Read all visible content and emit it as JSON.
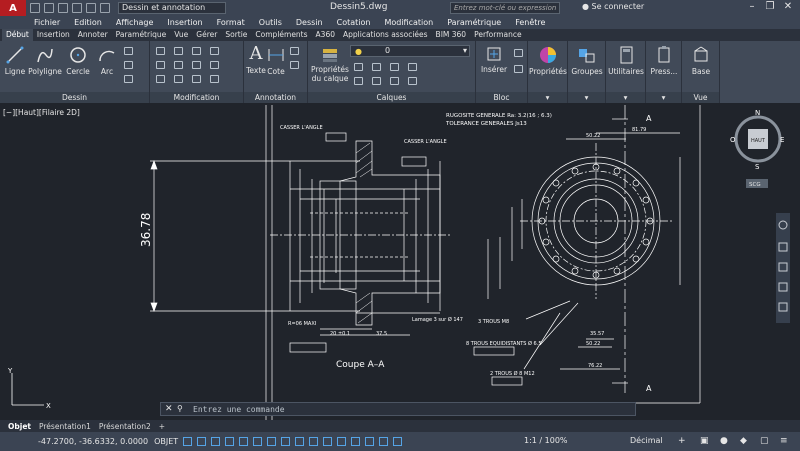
{
  "title_bar": {
    "logo": "A",
    "workspace": "Dessin et annotation",
    "document_title": "Dessin5.dwg",
    "search_placeholder": "Entrez mot-clé ou expression",
    "sign_in": "Se connecter"
  },
  "menu": [
    "Fichier",
    "Edition",
    "Affichage",
    "Insertion",
    "Format",
    "Outils",
    "Dessin",
    "Cotation",
    "Modification",
    "Paramétrique",
    "Fenêtre"
  ],
  "ribbon_tabs": [
    "Début",
    "Insertion",
    "Annoter",
    "Paramétrique",
    "Vue",
    "Gérer",
    "Sortie",
    "Compléments",
    "A360",
    "Applications associées",
    "BIM 360",
    "Performance"
  ],
  "ribbon_active_tab": "Début",
  "panels": {
    "dessin": {
      "label": "Dessin",
      "tools": [
        "Ligne",
        "Polyligne",
        "Cercle",
        "Arc"
      ]
    },
    "modification": {
      "label": "Modification"
    },
    "annotation": {
      "label": "Annotation",
      "tools": [
        "Texte",
        "Cote"
      ]
    },
    "calques": {
      "label": "Calques",
      "tools": [
        "Propriétés du calque"
      ],
      "layer_value": "0"
    },
    "bloc": {
      "label": "Bloc",
      "tools": [
        "Insérer"
      ]
    },
    "proprietes": {
      "label": "Propriétés"
    },
    "groupes": {
      "label": "Groupes"
    },
    "utilitaires": {
      "label": "Utilitaires"
    },
    "presse": {
      "label": "Press..."
    },
    "vue": {
      "label": "Vue",
      "tools": [
        "Base"
      ]
    }
  },
  "viewport_label": "[−][Haut][Filaire 2D]",
  "viewcube": {
    "face": "HAUT",
    "n": "N",
    "s": "S",
    "e": "E",
    "o": "O",
    "ucs": "SCG"
  },
  "drawing_text": {
    "rugosite": "RUGOSITE GENERALE Ra: 3.2(16 ; 6.3)",
    "tolerance": "TOLERANCE GENERALES Js13",
    "casser_angle_1": "CASSER L'ANGLE",
    "casser_angle_2": "CASSER L'ANGLE",
    "big_dim": "36.78",
    "coupe": "Coupe A–A",
    "section_a": "A",
    "dim_5022": "50.22",
    "dim_8179": "81.79",
    "dim_7622": "76.22",
    "dim_3557": "35.57",
    "trous_m8": "3 TROUS M8",
    "trous_equi": "8 TROUS EQUIDISTANTS Ø 6.5",
    "trous_m12": "2 TROUS Ø 8 M12",
    "r06": "R=06 MAXI",
    "dim_20": "20 ±0.1",
    "dim_375": "37.5",
    "lamage": "Lamage 3 sur Ø 147"
  },
  "command": {
    "placeholder": "Entrez une commande"
  },
  "layout_tabs": [
    "Objet",
    "Présentation1",
    "Présentation2",
    "+"
  ],
  "status": {
    "coords": "-47.2700, -36.6332, 0.0000",
    "mode": "OBJET",
    "scale": "1:1 / 100%",
    "units": "Décimal"
  },
  "colors": {
    "accent": "#b51d21",
    "ribbon": "#414a58",
    "canvas": "#20242b",
    "drawing_line": "#ffffff"
  }
}
